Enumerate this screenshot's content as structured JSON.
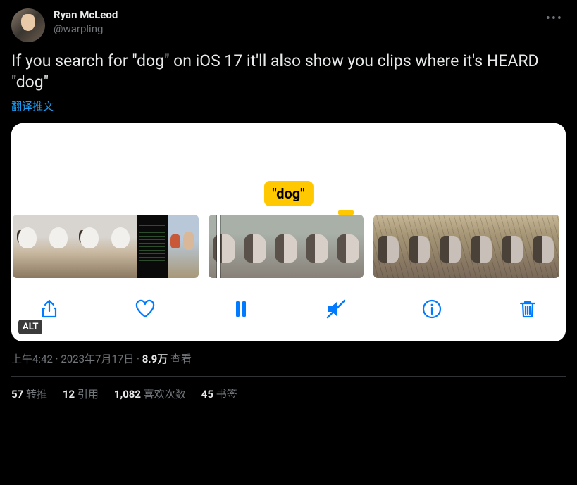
{
  "user": {
    "display_name": "Ryan McLeod",
    "handle": "@warpling"
  },
  "tweet_text": "If you search for \"dog\" on iOS 17 it'll also show you clips where it's HEARD \"dog\"",
  "translate_label": "翻译推文",
  "media": {
    "search_label": "\"dog\"",
    "alt_badge": "ALT",
    "toolbar_icons": {
      "share": "share-icon",
      "like": "heart-icon",
      "pause": "pause-icon",
      "mute": "mute-icon",
      "info": "info-icon",
      "delete": "trash-icon"
    }
  },
  "meta": {
    "time": "上午4:42",
    "separator": " · ",
    "date": "2023年7月17日",
    "views_count": "8.9万",
    "views_label": " 查看"
  },
  "stats": {
    "retweets_count": "57",
    "retweets_label": " 转推",
    "quotes_count": "12",
    "quotes_label": " 引用",
    "likes_count": "1,082",
    "likes_label": " 喜欢次数",
    "bookmarks_count": "45",
    "bookmarks_label": " 书签"
  }
}
